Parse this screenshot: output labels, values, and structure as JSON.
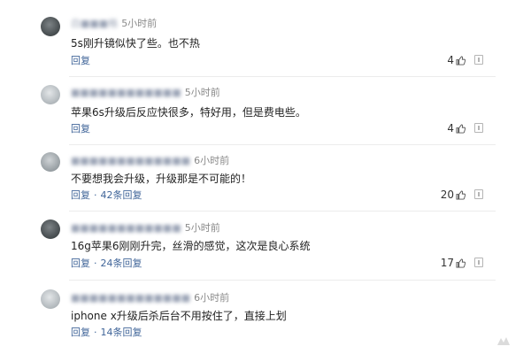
{
  "comments": [
    {
      "username": "白■■■格",
      "time": "5小时前",
      "text": "5s刚升镜似快了些。也不热",
      "reply_label": "回复",
      "replies_label": "",
      "likes": "4"
    },
    {
      "username": "■■■■■■■■■■■■",
      "time": "5小时前",
      "text": "苹果6s升级后反应快很多，特好用，但是费电些。",
      "reply_label": "回复",
      "replies_label": "",
      "likes": "4"
    },
    {
      "username": "■■■■■■■■■■■■■",
      "time": "6小时前",
      "text": "不要想我会升级，升级那是不可能的！",
      "reply_label": "回复",
      "replies_label": "42条回复",
      "likes": "20"
    },
    {
      "username": "■■■■■■■■■■■■",
      "time": "5小时前",
      "text": "16g苹果6刚刚升完，丝滑的感觉，这次是良心系统",
      "reply_label": "回复",
      "replies_label": "24条回复",
      "likes": "17"
    },
    {
      "username": "■■■■■■■■■■■■■",
      "time": "6小时前",
      "text": "iphone x升级后杀后台不用按住了，直接上划",
      "reply_label": "回复",
      "replies_label": "14条回复",
      "likes": ""
    }
  ],
  "icons": {
    "like": "thumbs-up-icon",
    "more": "report-icon"
  },
  "colors": {
    "link": "#406599",
    "time": "#8a8a8a",
    "divider": "#ececec"
  }
}
